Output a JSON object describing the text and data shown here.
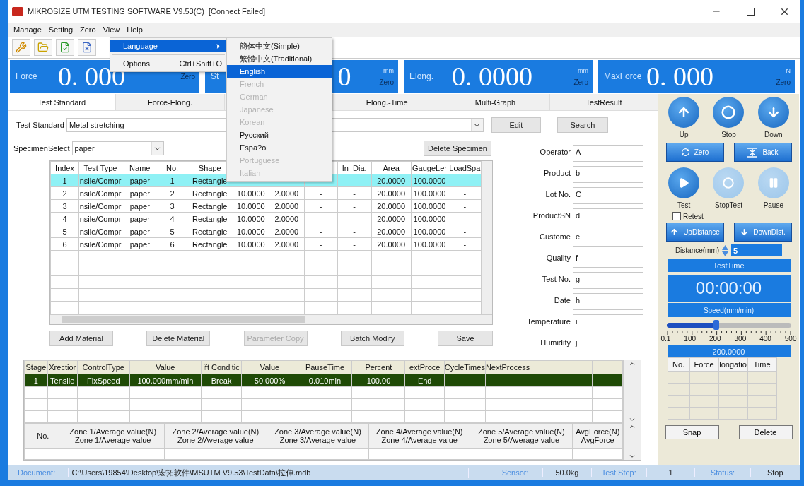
{
  "window": {
    "title": "MIKROSIZE UTM TESTING SOFTWARE V9.53(C)",
    "connection": "[Connect Failed]"
  },
  "menu_bar": [
    "Manage",
    "Setting",
    "Zero",
    "View",
    "Help"
  ],
  "view_menu": [
    {
      "label": "Language",
      "selected": true,
      "has_submenu": true
    },
    {
      "label": "Options",
      "shortcut": "Ctrl+Shift+O",
      "selected": false,
      "has_submenu": false
    }
  ],
  "language_menu": [
    {
      "label": "簡体中文(Simple)",
      "selected": false,
      "disabled": false
    },
    {
      "label": "繁體中文(Traditional)",
      "selected": false,
      "disabled": false
    },
    {
      "label": "English",
      "selected": true,
      "disabled": false
    },
    {
      "label": "French",
      "selected": false,
      "disabled": true
    },
    {
      "label": "German",
      "selected": false,
      "disabled": true
    },
    {
      "label": "Japanese",
      "selected": false,
      "disabled": true
    },
    {
      "label": "Korean",
      "selected": false,
      "disabled": true
    },
    {
      "label": "Русский",
      "selected": false,
      "disabled": false
    },
    {
      "label": "Espa?ol",
      "selected": false,
      "disabled": false
    },
    {
      "label": "Portuguese",
      "selected": false,
      "disabled": true
    },
    {
      "label": "Italian",
      "selected": false,
      "disabled": true
    }
  ],
  "readouts": [
    {
      "label": "Force",
      "value": "0. 000",
      "zero": "Zero"
    },
    {
      "label": "St",
      "value": "0",
      "unit": "mm",
      "zero": "Zero"
    },
    {
      "label": "Elong.",
      "value": "0. 0000",
      "unit": "mm",
      "zero": "Zero"
    },
    {
      "label": "MaxForce",
      "value": "0. 000",
      "unit": "N",
      "zero": "Zero"
    }
  ],
  "tabs": [
    {
      "label": "Test Standard",
      "selected": true
    },
    {
      "label": "Force-Elong.",
      "selected": false
    },
    {
      "selected": false
    },
    {
      "label": "Elong.-Time",
      "selected": false
    },
    {
      "label": "Multi-Graph",
      "selected": false
    },
    {
      "label": "TestResult",
      "selected": false
    }
  ],
  "test_standard": {
    "label": "Test Standard",
    "value": "Metal stretching",
    "edit_button": "Edit",
    "search_button": "Search"
  },
  "specimen_select": {
    "label": "SpecimenSelect",
    "value": "paper",
    "delete_button": "Delete Specimen"
  },
  "specimen_table": {
    "columns": [
      "Index",
      "Test Type",
      "Name",
      "No.",
      "Shape",
      null,
      null,
      null,
      "In_Dia.",
      "Area",
      "GaugeLer",
      "LoadSpa"
    ],
    "rows": [
      {
        "selected": true,
        "cells": [
          "1",
          "nsile/Compr",
          "paper",
          "1",
          "Rectangle",
          null,
          null,
          null,
          "-",
          "20.0000",
          "100.0000",
          "-"
        ]
      },
      {
        "selected": false,
        "cells": [
          "2",
          "nsile/Compr",
          "paper",
          "2",
          "Rectangle",
          "10.0000",
          "2.0000",
          "-",
          "-",
          "20.0000",
          "100.0000",
          "-"
        ]
      },
      {
        "selected": false,
        "cells": [
          "3",
          "nsile/Compr",
          "paper",
          "3",
          "Rectangle",
          "10.0000",
          "2.0000",
          "-",
          "-",
          "20.0000",
          "100.0000",
          "-"
        ]
      },
      {
        "selected": false,
        "cells": [
          "4",
          "nsile/Compr",
          "paper",
          "4",
          "Rectangle",
          "10.0000",
          "2.0000",
          "-",
          "-",
          "20.0000",
          "100.0000",
          "-"
        ]
      },
      {
        "selected": false,
        "cells": [
          "5",
          "nsile/Compr",
          "paper",
          "5",
          "Rectangle",
          "10.0000",
          "2.0000",
          "-",
          "-",
          "20.0000",
          "100.0000",
          "-"
        ]
      },
      {
        "selected": false,
        "cells": [
          "6",
          "nsile/Compr",
          "paper",
          "6",
          "Rectangle",
          "10.0000",
          "2.0000",
          "-",
          "-",
          "20.0000",
          "100.0000",
          "-"
        ]
      }
    ]
  },
  "material_buttons": [
    {
      "label": "Add Material",
      "disabled": false
    },
    {
      "label": "Delete  Material",
      "disabled": false
    },
    {
      "label": "Parameter Copy",
      "disabled": true
    },
    {
      "label": "Batch Modify",
      "disabled": false
    },
    {
      "label": "Save",
      "disabled": false
    }
  ],
  "info_fields": [
    {
      "label": "Operator",
      "value": "A"
    },
    {
      "label": "Product",
      "value": "b"
    },
    {
      "label": "Lot No.",
      "value": "C"
    },
    {
      "label": "ProductSN",
      "value": "d"
    },
    {
      "label": "Custome",
      "value": "e"
    },
    {
      "label": "Quality",
      "value": "f"
    },
    {
      "label": "Test No.",
      "value": "g"
    },
    {
      "label": "Date",
      "value": "h"
    },
    {
      "label": "Temperature",
      "value": "i"
    },
    {
      "label": "Humidity",
      "value": "j"
    }
  ],
  "stage_table": {
    "columns": [
      "Stage",
      "Xrectior",
      "ControlType",
      "Value",
      "ift Conditic",
      "Value",
      "PauseTime",
      "Percent",
      "extProce",
      "CycleTimes",
      "NextProcess",
      null,
      null,
      null
    ],
    "rows": [
      {
        "selected": true,
        "cells": [
          "1",
          "Tensile",
          "FixSpeed",
          "100.000mm/min",
          "Break",
          "50.000%",
          "0.010min",
          "100.00",
          "End",
          null,
          null,
          null,
          null,
          null
        ]
      }
    ]
  },
  "zone_table": {
    "columns": [
      {
        "lines": [
          "No."
        ]
      },
      {
        "lines": [
          "Zone 1/Average value(N)",
          "Zone 1/Average value"
        ]
      },
      {
        "lines": [
          "Zone 2/Average value(N)",
          "Zone 2/Average value"
        ]
      },
      {
        "lines": [
          "Zone 3/Average value(N)",
          "Zone 3/Average value"
        ]
      },
      {
        "lines": [
          "Zone 4/Average value(N)",
          "Zone 4/Average value"
        ]
      },
      {
        "lines": [
          "Zone 5/Average value(N)",
          "Zone 5/Average value"
        ]
      },
      {
        "lines": [
          "AvgForce(N)",
          "AvgForce"
        ]
      }
    ]
  },
  "control_panel": {
    "jog_buttons": [
      {
        "label": "Up",
        "kind": "up"
      },
      {
        "label": "Stop",
        "kind": "stop"
      },
      {
        "label": "Down",
        "kind": "down"
      }
    ],
    "zero_button": "Zero",
    "back_button": "Back",
    "test_buttons": [
      {
        "label": "Test",
        "kind": "play",
        "disabled": false
      },
      {
        "label": "StopTest",
        "kind": "stop",
        "disabled": true
      },
      {
        "label": "Pause",
        "kind": "pause",
        "disabled": true
      }
    ],
    "retest": {
      "label": "Retest",
      "checked": false
    },
    "distance_buttons": [
      {
        "label": "UpDistance",
        "kind": "up"
      },
      {
        "label": "DownDist.",
        "kind": "down"
      }
    ],
    "distance": {
      "label": "Distance(mm)",
      "value": "5"
    },
    "test_time": {
      "label": "TestTime",
      "value": "00:00:00"
    },
    "speed": {
      "label": "Speed(mm/min)",
      "level": 0.4,
      "ticks": [
        "0.1",
        "100",
        "200",
        "300",
        "400",
        "500"
      ],
      "value": "200.0000"
    },
    "reading_table": {
      "columns": [
        "No.",
        "Force",
        "longatio",
        "Time"
      ]
    },
    "snap_button": "Snap",
    "delete_button": "Delete"
  },
  "status_bar": {
    "document_label": "Document:",
    "document_path": "C:\\Users\\19854\\Desktop\\宏拓软件\\MSUTM V9.53\\TestData\\拉伸.mdb",
    "items": [
      {
        "label": "Sensor:",
        "value": "50.0kg"
      },
      {
        "label": "Test Step:",
        "value": "1"
      },
      {
        "label": "Status:",
        "value": "Stop"
      }
    ]
  }
}
